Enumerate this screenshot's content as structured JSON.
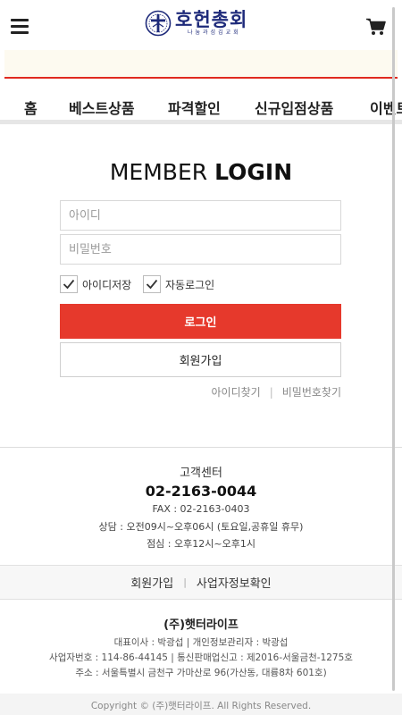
{
  "header": {
    "logo_title": "호헌총회",
    "logo_sub": "나눔과섬김교회",
    "logo_mark": "cross-emblem-icon",
    "menu_icon": "hamburger-icon",
    "cart_icon": "shopping-cart-icon"
  },
  "nav": {
    "items": [
      "홈",
      "베스트상품",
      "파격할인",
      "신규입점상품",
      "이벤트"
    ]
  },
  "login": {
    "title_light": "MEMBER",
    "title_bold": "LOGIN",
    "id_placeholder": "아이디",
    "pw_placeholder": "비밀번호",
    "save_id_label": "아이디저장",
    "save_id_checked": true,
    "auto_login_label": "자동로그인",
    "auto_login_checked": true,
    "login_button": "로그인",
    "join_button": "회원가입",
    "find_id": "아이디찾기",
    "link_sep": "|",
    "find_pw": "비밀번호찾기"
  },
  "customer_center": {
    "title": "고객센터",
    "phone": "02-2163-0044",
    "fax": "FAX : 02-2163-0403",
    "hours": "상담 : 오전09시~오후06시 (토요일,공휴일 휴무)",
    "lunch": "점심 : 오후12시~오후1시"
  },
  "footer_links": {
    "join": "회원가입",
    "sep": "|",
    "business_info": "사업자정보확인"
  },
  "company": {
    "name": "(주)햇터라이프",
    "line1": "대표이사 : 박광섭  |  개인정보관리자 : 박광섭",
    "line2": "사업자번호 : 114-86-44145  |  통신판매업신고 : 제2016-서울금천-1275호",
    "line3": "주소 : 서울특별시 금천구 가마산로 96(가산동, 대륭8차 601호)"
  },
  "copyright": "Copyright © (주)햇터라이프. All Rights Reserved.",
  "colors": {
    "accent_red": "#e6392c",
    "brand_navy": "#1e2a7a"
  }
}
